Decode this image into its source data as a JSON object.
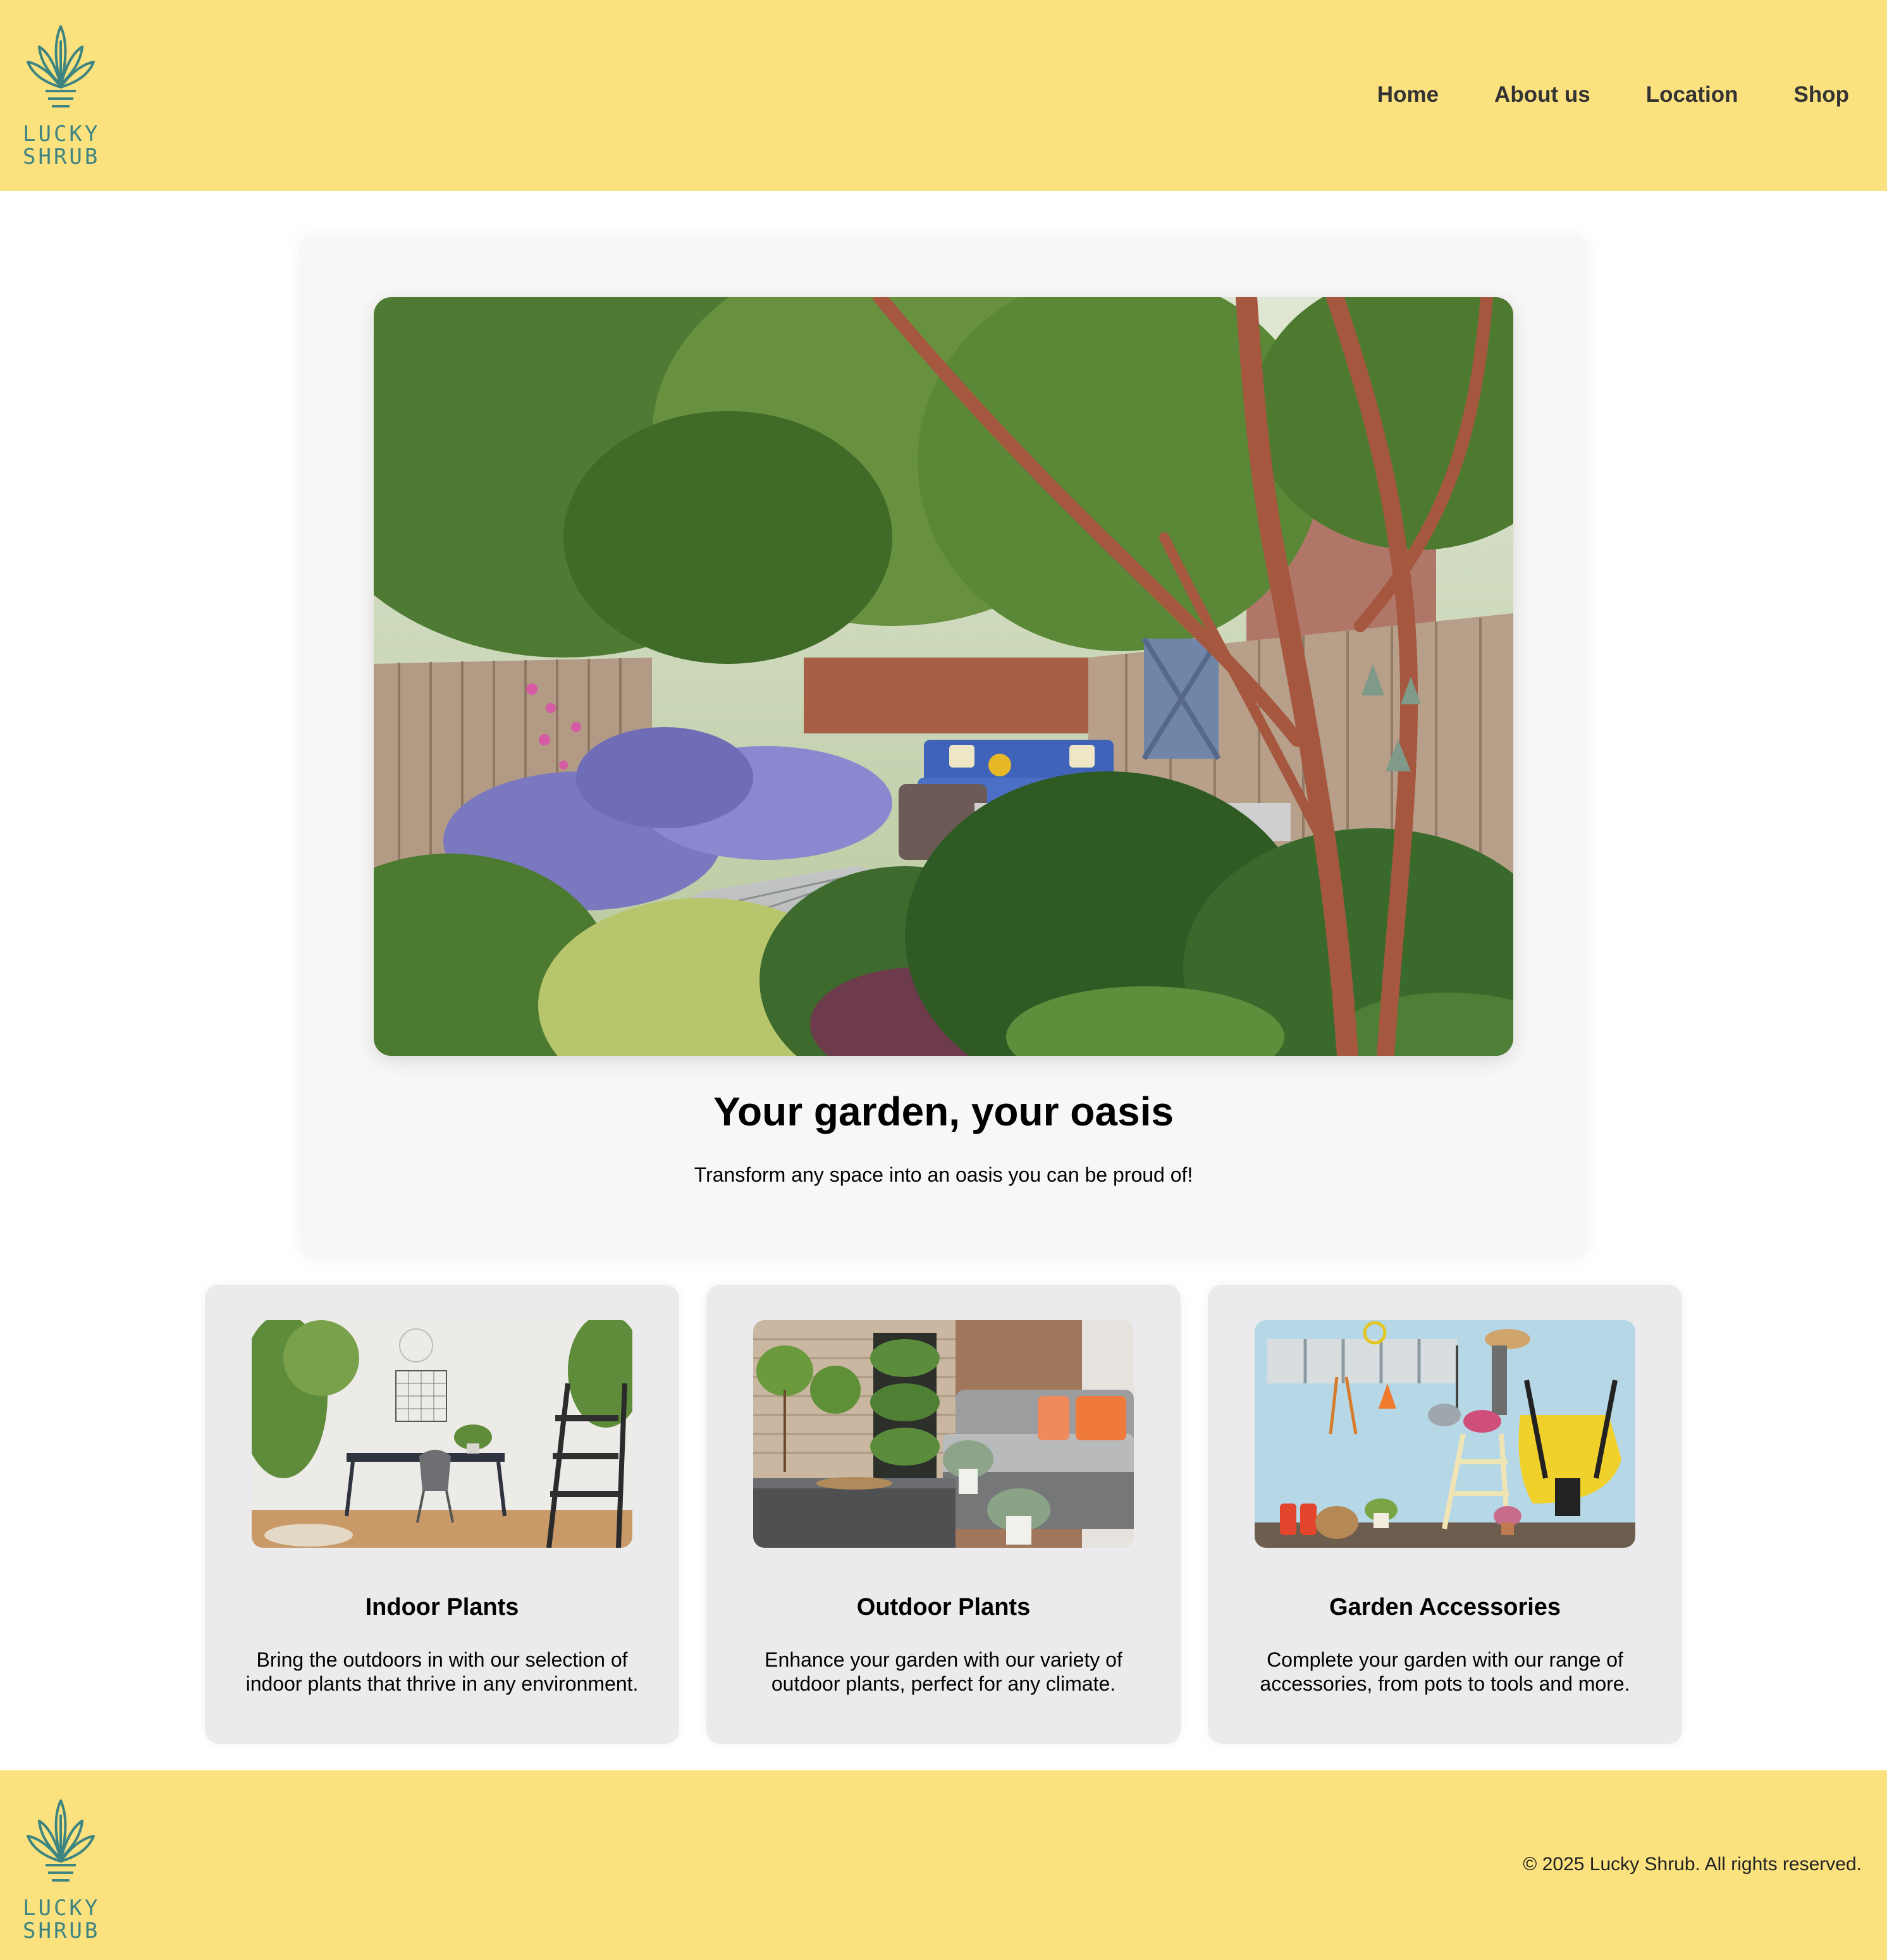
{
  "brand": {
    "logo_line1": "LUCKY",
    "logo_line2": "SHRUB",
    "logo_icon": "shrub-in-pot-icon",
    "color_primary": "#fbe27f",
    "color_logo": "#3e8481"
  },
  "nav": {
    "items": [
      "Home",
      "About us",
      "Location",
      "Shop"
    ]
  },
  "hero": {
    "image": "garden-backyard-photo",
    "title": "Your garden, your oasis",
    "subtitle": "Transform any space into an oasis you can be proud of!"
  },
  "categories": [
    {
      "image": "indoor-office-plants-photo",
      "title": "Indoor Plants",
      "description": "Bring the outdoors in with our selection of indoor plants that thrive in any environment."
    },
    {
      "image": "patio-outdoor-plants-photo",
      "title": "Outdoor Plants",
      "description": "Enhance your garden with our variety of outdoor plants, perfect for any climate."
    },
    {
      "image": "garden-tools-wall-photo",
      "title": "Garden Accessories",
      "description": "Complete your garden with our range of accessories, from pots to tools and more."
    }
  ],
  "footer": {
    "copyright": "© 2025 Lucky Shrub. All rights reserved."
  }
}
